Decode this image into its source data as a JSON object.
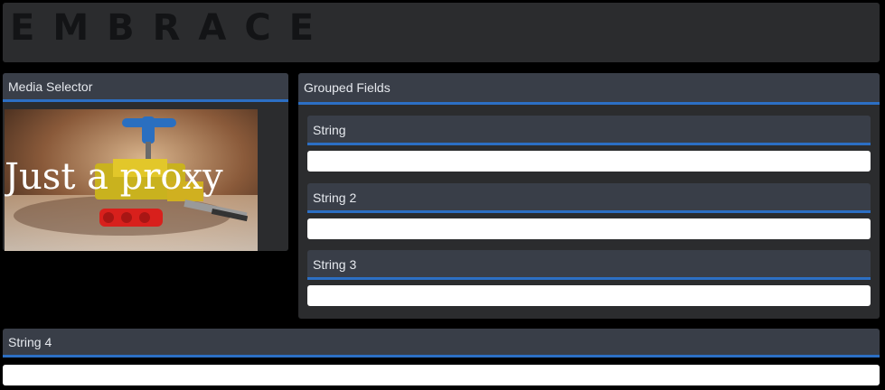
{
  "header": {
    "logo_text": "EMBRACE"
  },
  "media_selector": {
    "title": "Media Selector",
    "preview_caption": "Just a proxy"
  },
  "grouped_fields": {
    "title": "Grouped Fields",
    "fields": [
      {
        "label": "String",
        "value": ""
      },
      {
        "label": "String 2",
        "value": ""
      },
      {
        "label": "String 3",
        "value": ""
      }
    ]
  },
  "string4": {
    "label": "String 4",
    "value": ""
  },
  "colors": {
    "accent": "#2c6fc4",
    "panel_bg": "#2b2c2e",
    "panel_header_bg": "#393e48",
    "page_bg": "#000000"
  }
}
